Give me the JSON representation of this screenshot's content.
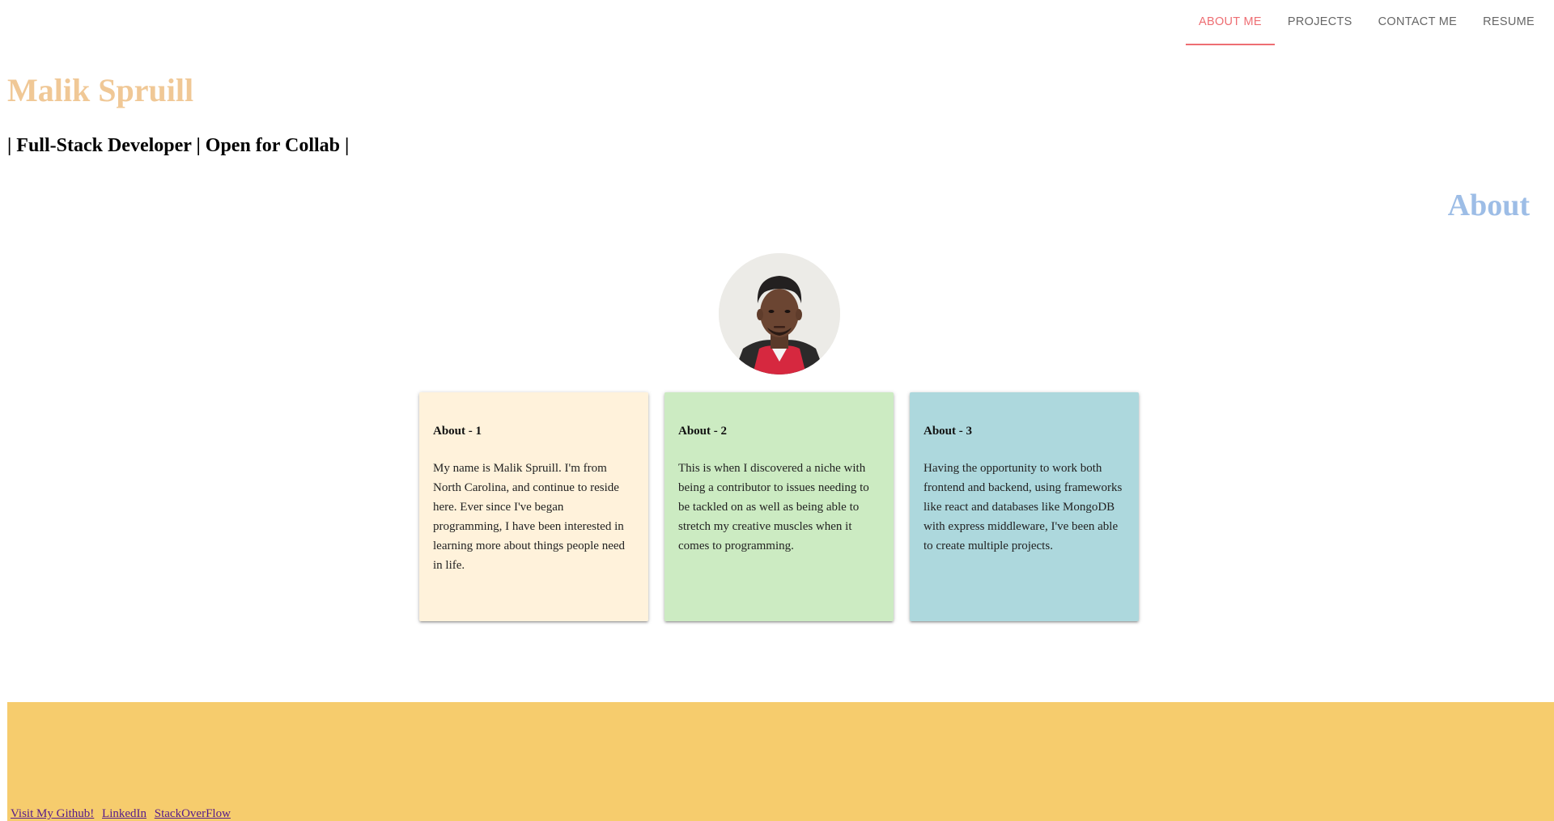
{
  "nav": {
    "tabs": [
      {
        "label": "ABOUT ME",
        "active": true
      },
      {
        "label": "PROJECTS",
        "active": false
      },
      {
        "label": "CONTACT ME",
        "active": false
      },
      {
        "label": "RESUME",
        "active": false
      }
    ]
  },
  "header": {
    "name": "Malik Spruill",
    "tagline": "| Full-Stack Developer | Open for Collab |"
  },
  "about": {
    "heading": "About",
    "avatar_icon": "profile-photo",
    "cards": [
      {
        "title": "About - 1",
        "text": "My name is Malik Spruill. I'm from North Carolina, and continue to reside here. Ever since I've began programming, I have been interested in learning more about things people need in life.",
        "color": "#fff2db"
      },
      {
        "title": "About - 2",
        "text": "This is when I discovered a niche with being a contributor to issues needing to be tackled on as well as being able to stretch my creative muscles when it comes to programming.",
        "color": "#ccebc2"
      },
      {
        "title": "About - 3",
        "text": "Having the opportunity to work both frontend and backend, using frameworks like react and databases like MongoDB with express middleware, I've been able to create multiple projects.",
        "color": "#add8dd"
      }
    ]
  },
  "footer": {
    "background": "#f6cc6d",
    "links": [
      {
        "label": "Visit My Github!"
      },
      {
        "label": "LinkedIn"
      },
      {
        "label": "StackOverFlow"
      }
    ]
  },
  "colors": {
    "name": "#f0c896",
    "about_heading": "#9dbde6",
    "active_tab": "#ee6e73"
  }
}
